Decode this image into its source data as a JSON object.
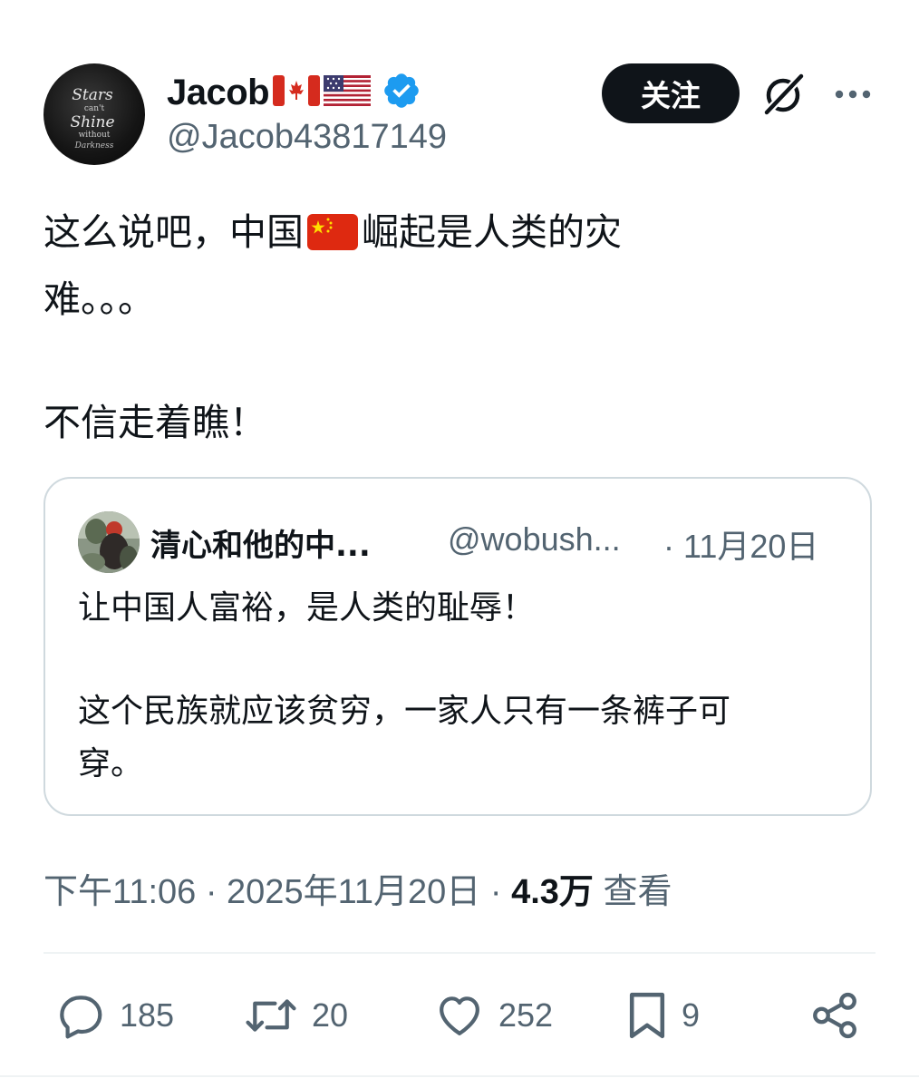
{
  "author": {
    "display_name": "Jacob",
    "handle": "@Jacob43817149",
    "avatar_text": "Stars can't Shine without Darkness",
    "flags": [
      "canada-flag-icon",
      "usa-flag-icon"
    ],
    "verified": true
  },
  "header": {
    "follow_label": "关注"
  },
  "tweet": {
    "line1_before_flag": "这么说吧，中国",
    "line1_after_flag": "崛起是人类的灾",
    "line2": "难。。。",
    "line3": "不信走着瞧！"
  },
  "quote": {
    "name": "清心和他的中...",
    "handle": "@wobush...",
    "date": "· 11月20日",
    "line1": "让中国人富裕，是人类的耻辱！",
    "line2": "这个民族就应该贫穷，一家人只有一条裤子可",
    "line3": "穿。"
  },
  "meta": {
    "timestamp": "下午11:06 · 2025年11月20日 · ",
    "views_count": "4.3万",
    "views_label": " 查看"
  },
  "actions": {
    "replies": "185",
    "reposts": "20",
    "likes": "252",
    "bookmarks": "9"
  },
  "colors": {
    "text_primary": "#0f1419",
    "text_secondary": "#536471",
    "border": "#cfd9de",
    "verified_blue": "#1d9bf0",
    "button_dark": "#0f1419"
  }
}
